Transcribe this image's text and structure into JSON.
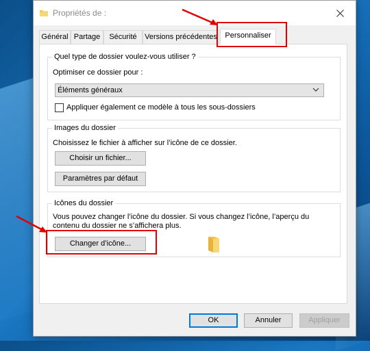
{
  "window": {
    "title": "Propriétés de :"
  },
  "tabs": [
    {
      "label": "Général"
    },
    {
      "label": "Partage"
    },
    {
      "label": "Sécurité"
    },
    {
      "label": "Versions précédentes"
    },
    {
      "label": "Personnaliser"
    }
  ],
  "folder_type": {
    "legend": "Quel type de dossier voulez-vous utiliser ?",
    "optimize_label": "Optimiser ce dossier pour :",
    "selected_value": "Éléments généraux",
    "checkbox_label": "Appliquer également ce modèle à tous les sous-dossiers",
    "checkbox_checked": false
  },
  "folder_images": {
    "legend": "Images du dossier",
    "description": "Choisissez le fichier à afficher sur l’icône de ce dossier.",
    "choose_file_button": "Choisir un fichier...",
    "default_settings_button": "Paramètres par défaut"
  },
  "folder_icons": {
    "legend": "Icônes du dossier",
    "description_line1": "Vous pouvez changer l’icône du dossier. Si vous changez l’icône, l’aperçu du",
    "description_line2": "contenu du dossier ne s’affichera plus.",
    "change_icon_button": "Changer d’icône..."
  },
  "footer": {
    "ok_label": "OK",
    "cancel_label": "Annuler",
    "apply_label": "Appliquer"
  },
  "icons": [
    "folder-icon",
    "close-icon",
    "chevron-down-icon",
    "arrow-icon"
  ],
  "colors": {
    "annotation_red": "#e00000",
    "accent_blue": "#0078d7",
    "folder_yellow": "#f5c542"
  }
}
